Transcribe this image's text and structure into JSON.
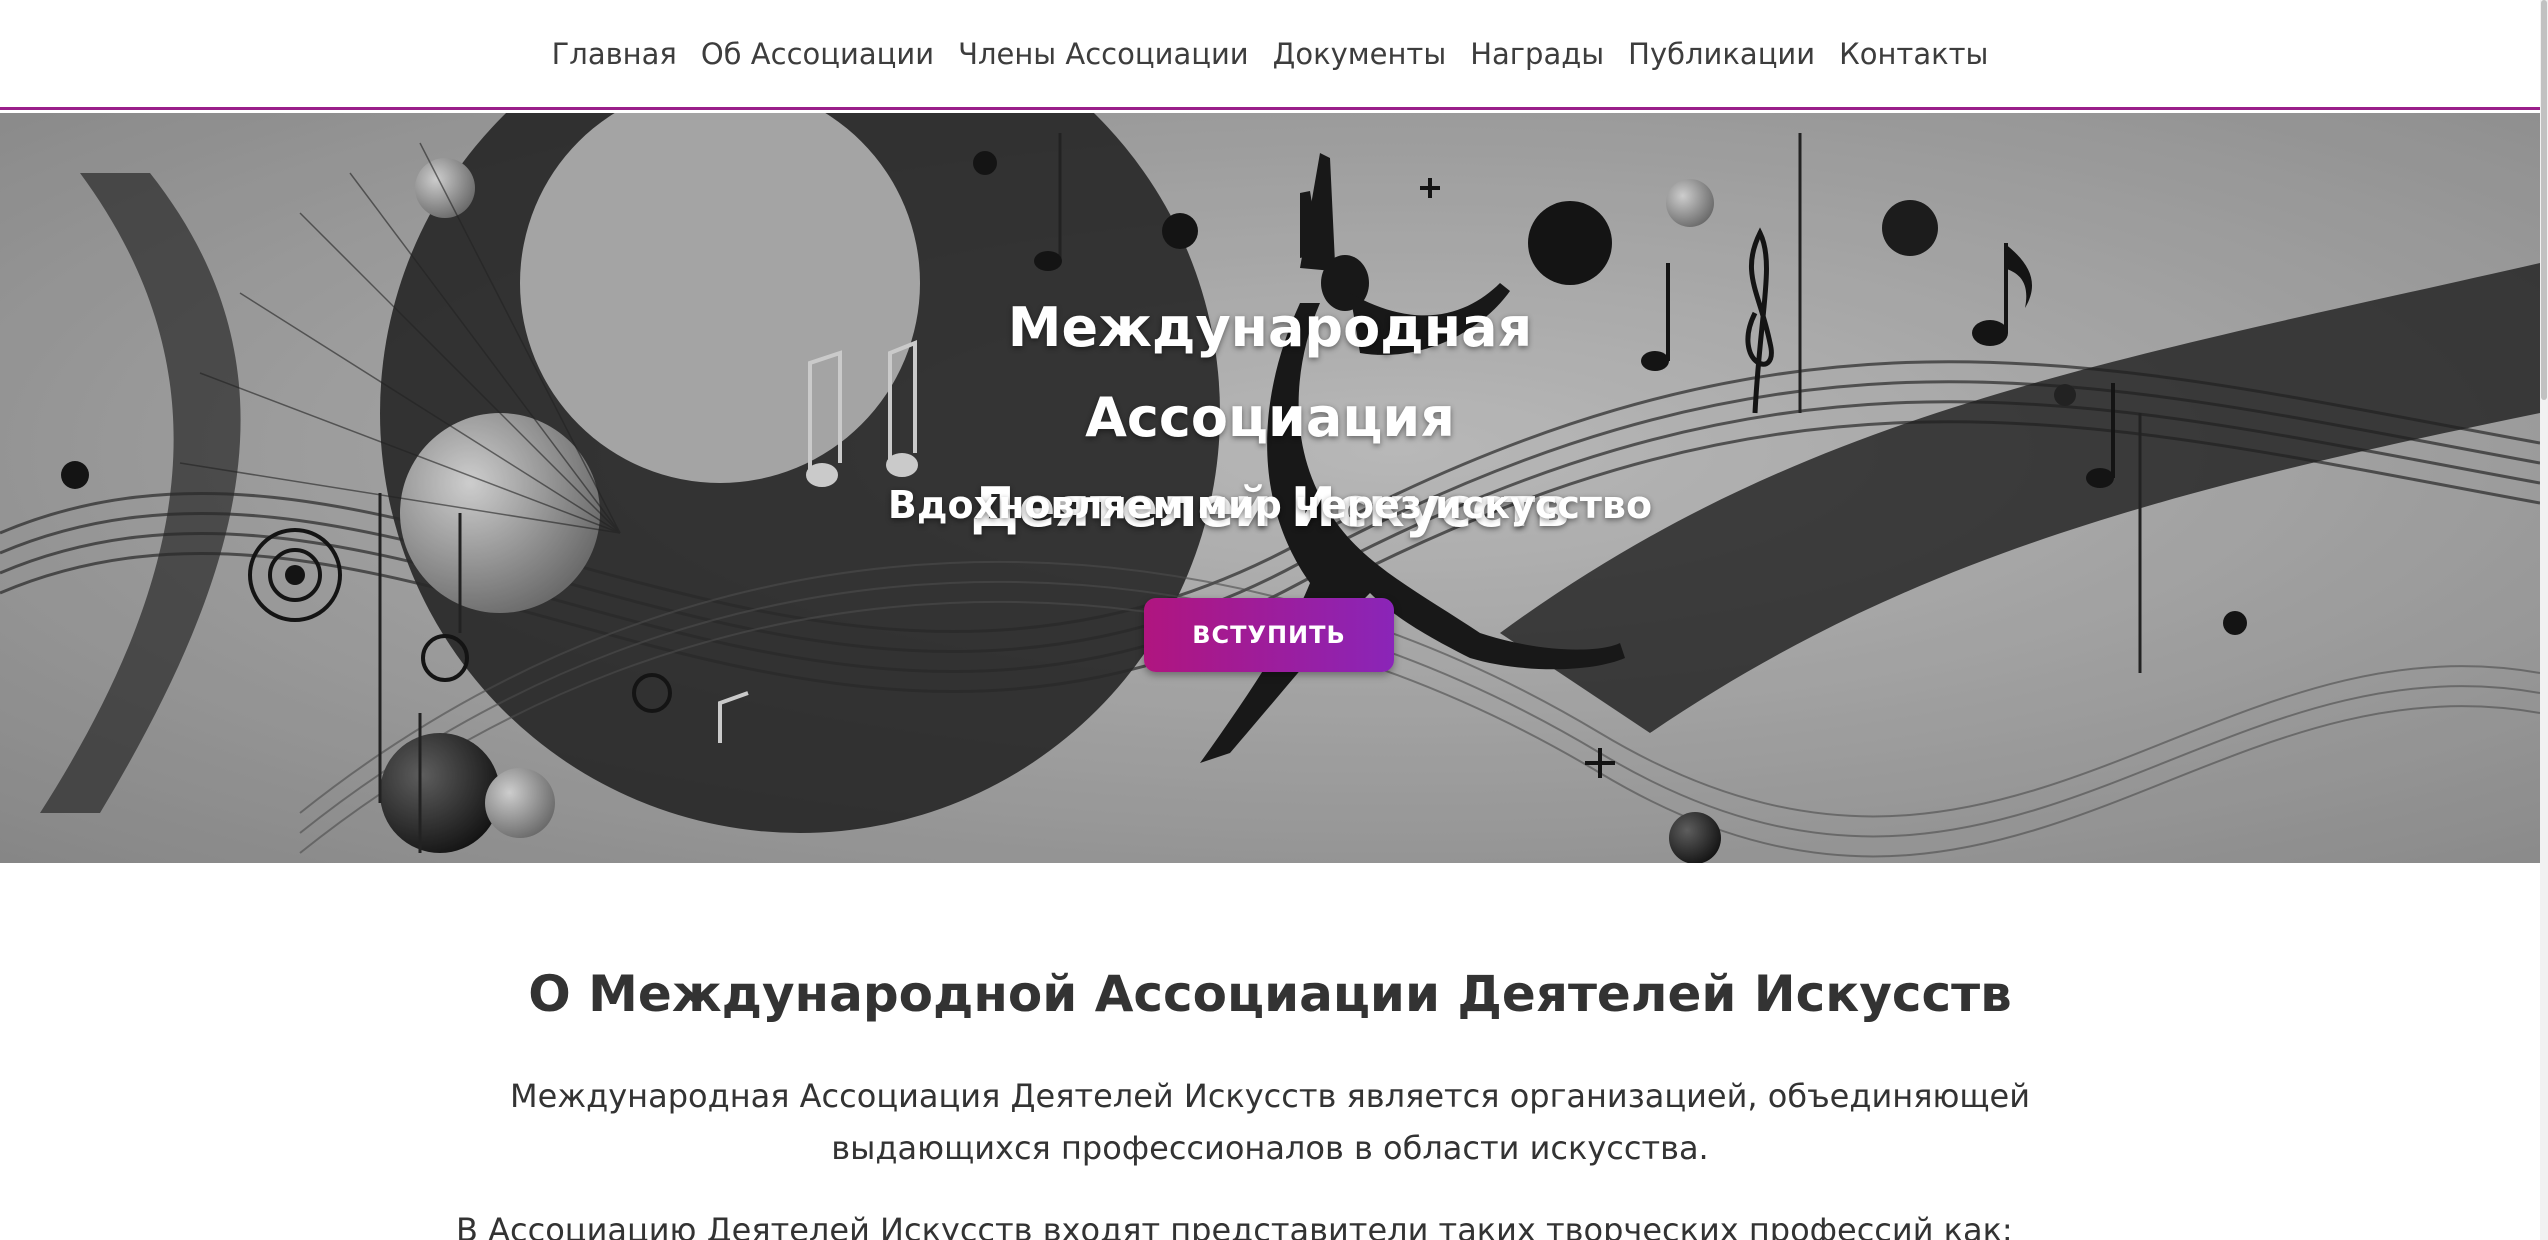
{
  "nav": {
    "items": [
      {
        "label": "Главная"
      },
      {
        "label": "Об Ассоциации"
      },
      {
        "label": "Члены Ассоциации"
      },
      {
        "label": "Документы"
      },
      {
        "label": "Награды"
      },
      {
        "label": "Публикации"
      },
      {
        "label": "Контакты"
      }
    ],
    "accent_color": "#9a1f8a"
  },
  "hero": {
    "title_line1": "Международная Ассоциация",
    "title_line2": "Деятелей Искусств",
    "subtitle": "Вдохновляем мир через искусство",
    "button_label": "ВСТУПИТЬ",
    "button_gradient": [
      "#b0157f",
      "#8a25b8"
    ],
    "background_image": "music-dance-abstract-illustration"
  },
  "about": {
    "title": "О Международной Ассоциации Деятелей Искусств",
    "paragraph1": "Международная Ассоциация Деятелей Искусств является организацией, объединяющей выдающихся профессионалов в области искусства.",
    "paragraph2": "В Ассоциацию Деятелей Искусств входят представители таких творческих профессий как:"
  }
}
